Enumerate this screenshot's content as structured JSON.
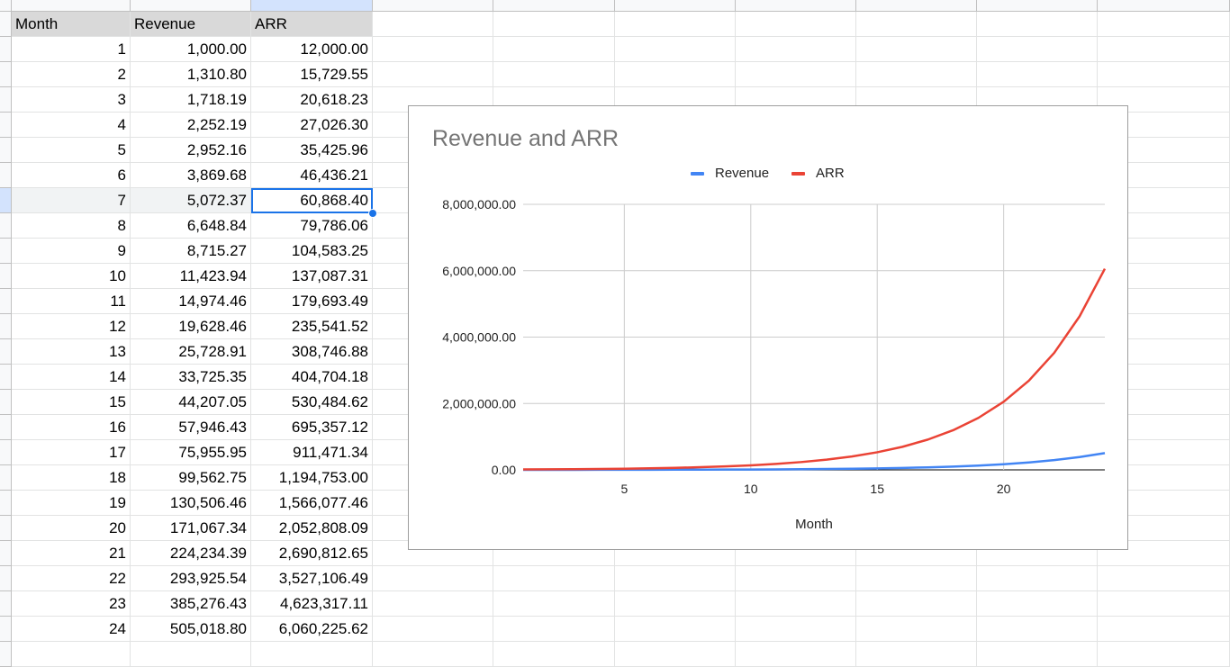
{
  "sheet": {
    "header": {
      "month": "Month",
      "revenue": "Revenue",
      "arr": "ARR"
    },
    "rows": [
      {
        "month": "1",
        "revenue": "1,000.00",
        "arr": "12,000.00"
      },
      {
        "month": "2",
        "revenue": "1,310.80",
        "arr": "15,729.55"
      },
      {
        "month": "3",
        "revenue": "1,718.19",
        "arr": "20,618.23"
      },
      {
        "month": "4",
        "revenue": "2,252.19",
        "arr": "27,026.30"
      },
      {
        "month": "5",
        "revenue": "2,952.16",
        "arr": "35,425.96"
      },
      {
        "month": "6",
        "revenue": "3,869.68",
        "arr": "46,436.21"
      },
      {
        "month": "7",
        "revenue": "5,072.37",
        "arr": "60,868.40"
      },
      {
        "month": "8",
        "revenue": "6,648.84",
        "arr": "79,786.06"
      },
      {
        "month": "9",
        "revenue": "8,715.27",
        "arr": "104,583.25"
      },
      {
        "month": "10",
        "revenue": "11,423.94",
        "arr": "137,087.31"
      },
      {
        "month": "11",
        "revenue": "14,974.46",
        "arr": "179,693.49"
      },
      {
        "month": "12",
        "revenue": "19,628.46",
        "arr": "235,541.52"
      },
      {
        "month": "13",
        "revenue": "25,728.91",
        "arr": "308,746.88"
      },
      {
        "month": "14",
        "revenue": "33,725.35",
        "arr": "404,704.18"
      },
      {
        "month": "15",
        "revenue": "44,207.05",
        "arr": "530,484.62"
      },
      {
        "month": "16",
        "revenue": "57,946.43",
        "arr": "695,357.12"
      },
      {
        "month": "17",
        "revenue": "75,955.95",
        "arr": "911,471.34"
      },
      {
        "month": "18",
        "revenue": "99,562.75",
        "arr": "1,194,753.00"
      },
      {
        "month": "19",
        "revenue": "130,506.46",
        "arr": "1,566,077.46"
      },
      {
        "month": "20",
        "revenue": "171,067.34",
        "arr": "2,052,808.09"
      },
      {
        "month": "21",
        "revenue": "224,234.39",
        "arr": "2,690,812.65"
      },
      {
        "month": "22",
        "revenue": "293,925.54",
        "arr": "3,527,106.49"
      },
      {
        "month": "23",
        "revenue": "385,276.43",
        "arr": "4,623,317.11"
      },
      {
        "month": "24",
        "revenue": "505,018.80",
        "arr": "6,060,225.62"
      }
    ],
    "active_cell": {
      "row": 7,
      "column": "arr"
    },
    "colors": {
      "selection": "#1a73e8",
      "header_fill": "#d9d9d9"
    }
  },
  "chart": {
    "title": "Revenue and ARR",
    "xlabel": "Month",
    "legend": [
      {
        "name": "Revenue",
        "color": "#4285f4"
      },
      {
        "name": "ARR",
        "color": "#ea4335"
      }
    ],
    "yticks": [
      "0.00",
      "2,000,000.00",
      "4,000,000.00",
      "6,000,000.00",
      "8,000,000.00"
    ],
    "xticks": [
      "5",
      "10",
      "15",
      "20"
    ]
  },
  "chart_data": {
    "type": "line",
    "title": "Revenue and ARR",
    "xlabel": "Month",
    "ylabel": "",
    "x": [
      1,
      2,
      3,
      4,
      5,
      6,
      7,
      8,
      9,
      10,
      11,
      12,
      13,
      14,
      15,
      16,
      17,
      18,
      19,
      20,
      21,
      22,
      23,
      24
    ],
    "xlim": [
      1,
      24
    ],
    "ylim": [
      0,
      8000000
    ],
    "grid": true,
    "legend": "top",
    "series": [
      {
        "name": "Revenue",
        "color": "#4285f4",
        "values": [
          1000.0,
          1310.8,
          1718.19,
          2252.19,
          2952.16,
          3869.68,
          5072.37,
          6648.84,
          8715.27,
          11423.94,
          14974.46,
          19628.46,
          25728.91,
          33725.35,
          44207.05,
          57946.43,
          75955.95,
          99562.75,
          130506.46,
          171067.34,
          224234.39,
          293925.54,
          385276.43,
          505018.8
        ]
      },
      {
        "name": "ARR",
        "color": "#ea4335",
        "values": [
          12000.0,
          15729.55,
          20618.23,
          27026.3,
          35425.96,
          46436.21,
          60868.4,
          79786.06,
          104583.25,
          137087.31,
          179693.49,
          235541.52,
          308746.88,
          404704.18,
          530484.62,
          695357.12,
          911471.34,
          1194753.0,
          1566077.46,
          2052808.09,
          2690812.65,
          3527106.49,
          4623317.11,
          6060225.62
        ]
      }
    ]
  }
}
